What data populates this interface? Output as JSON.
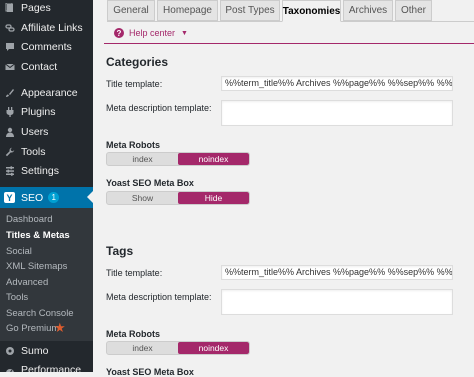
{
  "colors": {
    "sidebar_bg": "#23282d",
    "submenu_bg": "#32373c",
    "current_menu_bg": "#0073aa",
    "accent_purple": "#a4286a",
    "go_premium_star": "#dc5c2e"
  },
  "sidebar": {
    "items": [
      {
        "label": "Pages",
        "icon": "pages-icon"
      },
      {
        "label": "Affiliate Links",
        "icon": "link-icon"
      },
      {
        "label": "Comments",
        "icon": "comment-icon"
      },
      {
        "label": "Contact",
        "icon": "mail-icon"
      },
      {
        "label": "Appearance",
        "icon": "brush-icon"
      },
      {
        "label": "Plugins",
        "icon": "plugin-icon"
      },
      {
        "label": "Users",
        "icon": "users-icon"
      },
      {
        "label": "Tools",
        "icon": "wrench-icon"
      },
      {
        "label": "Settings",
        "icon": "settings-icon"
      }
    ],
    "seo": {
      "label": "SEO",
      "badge": "1",
      "logo": "Y"
    },
    "submenu": [
      {
        "label": "Dashboard"
      },
      {
        "label": "Titles & Metas"
      },
      {
        "label": "Social"
      },
      {
        "label": "XML Sitemaps"
      },
      {
        "label": "Advanced"
      },
      {
        "label": "Tools"
      },
      {
        "label": "Search Console"
      },
      {
        "label": "Go Premium"
      }
    ],
    "after": [
      {
        "label": "Sumo",
        "icon": "sumo-icon"
      },
      {
        "label": "Performance",
        "icon": "performance-icon"
      }
    ]
  },
  "tabs": [
    "General",
    "Homepage",
    "Post Types",
    "Taxonomies",
    "Archives",
    "Other"
  ],
  "active_tab": "Taxonomies",
  "help": {
    "label": "Help center",
    "icon": "?"
  },
  "sections": [
    {
      "title": "Categories",
      "title_template_label": "Title template:",
      "title_template_value": "%%term_title%% Archives %%page%% %%sep%% %%sitename%%",
      "meta_desc_label": "Meta description template:",
      "meta_robots_label": "Meta Robots",
      "meta_robots_options": [
        "index",
        "noindex"
      ],
      "meta_robots_selected": "noindex",
      "meta_box_label": "Yoast SEO Meta Box",
      "meta_box_options": [
        "Show",
        "Hide"
      ],
      "meta_box_selected": "Hide"
    },
    {
      "title": "Tags",
      "title_template_label": "Title template:",
      "title_template_value": "%%term_title%% Archives %%page%% %%sep%% %%sitename%%",
      "meta_desc_label": "Meta description template:",
      "meta_robots_label": "Meta Robots",
      "meta_robots_options": [
        "index",
        "noindex"
      ],
      "meta_robots_selected": "noindex",
      "meta_box_label": "Yoast SEO Meta Box"
    }
  ]
}
